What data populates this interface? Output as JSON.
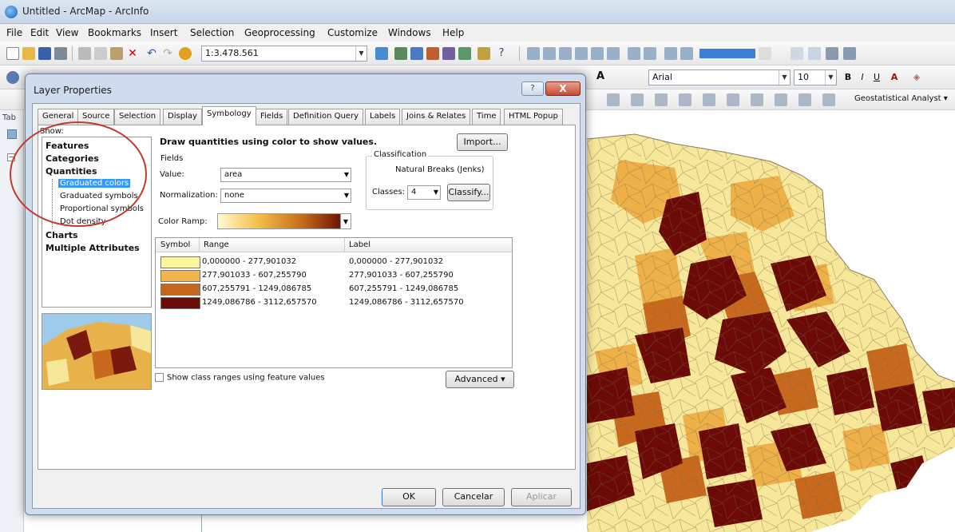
{
  "app": {
    "title": "Untitled - ArcMap - ArcInfo",
    "menu": [
      "File",
      "Edit",
      "View",
      "Bookmarks",
      "Insert",
      "Selection",
      "Geoprocessing",
      "Customize",
      "Windows",
      "Help"
    ],
    "scale_value": "1:3.478.561",
    "font_name": "Arial",
    "font_size": "10",
    "font_styles": [
      "B",
      "I",
      "U"
    ],
    "geostatistical_label": "Geostatistical Analyst ▾",
    "left_panel_tab": "Tab"
  },
  "dialog": {
    "title": "Layer Properties",
    "help_label": "?",
    "close_label": "X",
    "tabs": [
      "General",
      "Source",
      "Selection",
      "Display",
      "Symbology",
      "Fields",
      "Definition Query",
      "Labels",
      "Joins & Relates",
      "Time",
      "HTML Popup"
    ],
    "active_tab": "Symbology",
    "show_label": "Show:",
    "tree": {
      "features": "Features",
      "categories": "Categories",
      "quantities": "Quantities",
      "graduated_colors": "Graduated colors",
      "graduated_symbols": "Graduated symbols",
      "proportional_symbols": "Proportional symbols",
      "dot_density": "Dot density",
      "charts": "Charts",
      "multiple_attributes": "Multiple Attributes"
    },
    "heading": "Draw quantities using color to show values.",
    "import_label": "Import...",
    "fields_legend": "Fields",
    "value_label": "Value:",
    "value_field": "area",
    "normalization_label": "Normalization:",
    "normalization_value": "none",
    "classification_legend": "Classification",
    "classification_method": "Natural Breaks (Jenks)",
    "classes_label": "Classes:",
    "classes_value": "4",
    "classify_label": "Classify...",
    "color_ramp_label": "Color Ramp:",
    "table": {
      "columns": [
        "Symbol",
        "Range",
        "Label"
      ],
      "rows": [
        {
          "color": "#fff6a0",
          "range": "0,000000 - 277,901032",
          "label": "0,000000 - 277,901032"
        },
        {
          "color": "#f3b54a",
          "range": "277,901033 - 607,255790",
          "label": "277,901033 - 607,255790"
        },
        {
          "color": "#c4661e",
          "range": "607,255791 - 1249,086785",
          "label": "607,255791 - 1249,086785"
        },
        {
          "color": "#6b0a06",
          "range": "1249,086786 - 3112,657570",
          "label": "1249,086786 - 3112,657570"
        }
      ]
    },
    "show_ranges_label": "Show class ranges using feature values",
    "advanced_label": "Advanced",
    "ok_label": "OK",
    "cancel_label": "Cancelar",
    "apply_label": "Aplicar"
  },
  "colors": {
    "class1": "#fff6a0",
    "class2": "#f3b54a",
    "class3": "#c4661e",
    "class4": "#6b0a06",
    "highlight_oval": "#c0392b",
    "selection": "#3399ff"
  }
}
